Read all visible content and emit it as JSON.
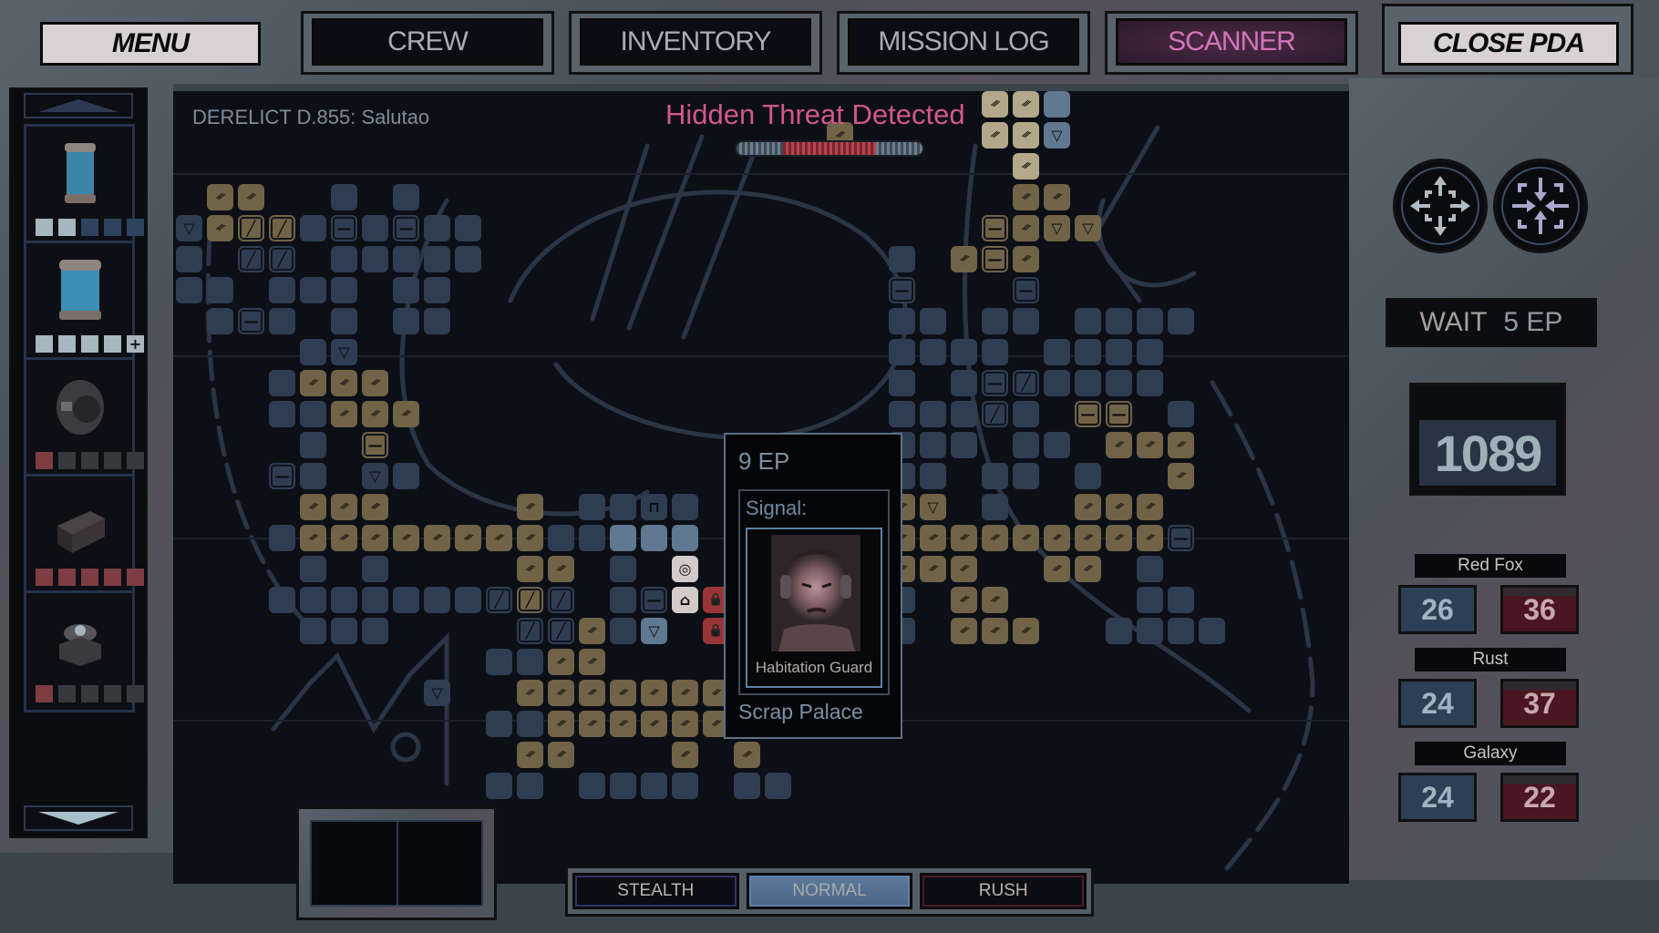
{
  "topbar": {
    "menu": "MENU",
    "tabs": [
      {
        "label": "CREW",
        "active": false
      },
      {
        "label": "INVENTORY",
        "active": false
      },
      {
        "label": "MISSION LOG",
        "active": false
      },
      {
        "label": "SCANNER",
        "active": true
      }
    ],
    "close": "CLOSE PDA"
  },
  "scanner": {
    "location": "DERELICT D.855: Salutao",
    "alert": "Hidden Threat Detected",
    "threat_level": 0.5,
    "alert_color": "#d2568f"
  },
  "map": {
    "legend": {
      ".": "empty",
      "b": "explored-room",
      "B": "highlighted-room",
      "g": "scrap-room",
      "G": "scrap-room-highlighted",
      "-": "door",
      "=": "scrap-door",
      "/": "breach",
      "%": "scrap-breach",
      "v": "hazard",
      "V": "scrap-hazard",
      "w": "hazard-highlighted",
      "o": "target",
      "h": "home",
      "l": "locked",
      "t": "terminal",
      "T": "terminal-highlighted"
    },
    "rows": [
      "..........................GGB.....",
      ".....................g....GGw.....",
      "...........................G......",
      ".gg..b.b...................gg.....",
      "vg%%b-b-bb................=gVV....",
      "b.//.bbbbb.............b.g=g......",
      "bb.bbb.bb..............-...-......",
      ".b-b.b.bb..............bb.bb.bbbb.",
      "....bv.................bbbb.bbbb..",
      "...bggg................b.b-/bbbb..",
      "...bbggg...............bbb/b.==.b.",
      "....b.=................bbb.bb.ggg.",
      "...-b.vb...............bb.bb.b..g.",
      "....ggg....g.bbtb......gV.b..ggg..",
      "...bggggggggbbBBB....bbggggggggg-.",
      "....b.b....gg.b.o....bbggg..gg.b..",
      "...bbbbbbb/%/.b-hl.....b.gg....bb.",
      "....bbb....//gbw.l.....b.ggg..bbbb",
      "..........bbgg....gg..............",
      "........v..ggggggggg..............",
      "..........bbggggggggg.............",
      "...........gg...g.g...............",
      "..........bb.bbbb.bb.............."
    ]
  },
  "tooltip": {
    "cost": "9 EP",
    "signal_label": "Signal:",
    "signal_name": "Habitation Guard",
    "location": "Scrap Palace"
  },
  "inventory": {
    "items": [
      {
        "name": "small-energy-cell",
        "pips": [
          "#a7b6bf",
          "#a7b6bf",
          "#2e435d",
          "#2e435d",
          "#2e435d"
        ],
        "plus": false
      },
      {
        "name": "large-energy-cell",
        "pips": [
          "#a7b6bf",
          "#a7b6bf",
          "#a7b6bf",
          "#a7b6bf",
          "#a7b6bf"
        ],
        "plus": true
      },
      {
        "name": "turbine-module",
        "pips": [
          "#7c3d43",
          "#38393c",
          "#38393c",
          "#38393c",
          "#38393c"
        ],
        "plus": false
      },
      {
        "name": "supply-crate",
        "pips": [
          "#7c3d43",
          "#7c3d43",
          "#7c3d43",
          "#7c3d43",
          "#7c3d43"
        ],
        "plus": false
      },
      {
        "name": "sensor-device",
        "pips": [
          "#7c3d43",
          "#38393c",
          "#38393c",
          "#38393c",
          "#38393c"
        ],
        "plus": false
      }
    ]
  },
  "controls": {
    "wait_label": "WAIT",
    "wait_cost": "5 EP",
    "counter": "1089",
    "expand_icon": "expand-arrows-icon",
    "collapse_icon": "collapse-arrows-icon"
  },
  "crew": [
    {
      "name": "Red Fox",
      "blue": "26",
      "red": "36"
    },
    {
      "name": "Rust",
      "blue": "24",
      "red": "37"
    },
    {
      "name": "Galaxy",
      "blue": "24",
      "red": "22"
    }
  ],
  "modes": [
    {
      "label": "STEALTH",
      "active": false,
      "border": "#2e3566"
    },
    {
      "label": "NORMAL",
      "active": true,
      "border": "#5d80a6"
    },
    {
      "label": "RUSH",
      "active": false,
      "border": "#4a1c26"
    }
  ]
}
